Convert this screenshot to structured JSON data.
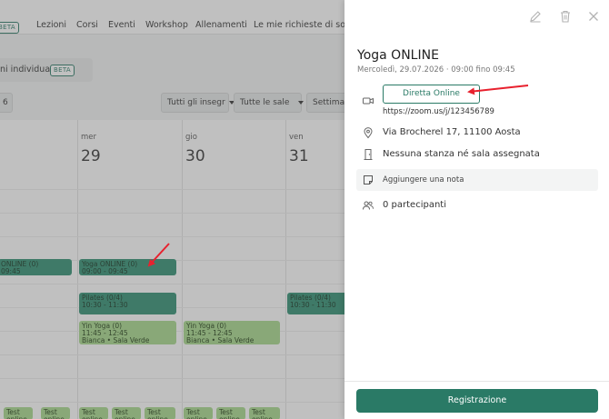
{
  "topnav": {
    "beta": "BETA",
    "items": [
      "Lezioni",
      "Corsi",
      "Eventi",
      "Workshop",
      "Allenamenti",
      "Le mie richieste di sostitu"
    ]
  },
  "subbar": {
    "mode_label": "ni individuali",
    "mode_badge": "BETA",
    "small_value": "6",
    "filters": [
      "Tutti gli insegr",
      "Tutte le sale",
      "Settimana"
    ]
  },
  "calendar": {
    "days": [
      {
        "name": "mer",
        "num": "29"
      },
      {
        "name": "gio",
        "num": "30"
      },
      {
        "name": "ven",
        "num": "31"
      }
    ],
    "events": {
      "e0": {
        "l1": "ONLINE (0)",
        "l2": "09:45"
      },
      "e1": {
        "l1": "Yoga ONLINE (0)",
        "l2": "09:00 - 09:45"
      },
      "e2": {
        "l1": "Pilates (0/4)",
        "l2": "10:30 - 11:30"
      },
      "e3": {
        "l1": "Yin Yoga (0)",
        "l2": "11:45 - 12:45",
        "l3": "Bianca • Sala Verde"
      },
      "e4": {
        "l1": "Yin Yoga (0)",
        "l2": "11:45 - 12:45",
        "l3": "Bianca • Sala Verde"
      },
      "e5": {
        "l1": "Pilates (0/4)",
        "l2": "10:30 - 11:30"
      },
      "test": {
        "l1": "Test",
        "l2": "online"
      }
    }
  },
  "panel": {
    "title": "Yoga ONLINE",
    "datetime": "Mercoledì, 29.07.2026 · 09:00 fino 09:45",
    "live_button": "Diretta Online",
    "zoom_link": "https://zoom.us/j/123456789",
    "address": "Via Brocherel 17, 11100 Aosta",
    "room": "Nessuna stanza né sala assegnata",
    "note": "Aggiungere una nota",
    "participants": "0 partecipanti",
    "register_button": "Registrazione"
  },
  "colors": {
    "accent": "#2a7a66",
    "event_dark": "#2f8f71",
    "event_light": "#a6d98c",
    "arrow": "#e8212e"
  },
  "icons": [
    "edit-icon",
    "trash-icon",
    "close-icon",
    "video-icon",
    "location-pin-icon",
    "door-icon",
    "note-icon",
    "participants-icon"
  ]
}
